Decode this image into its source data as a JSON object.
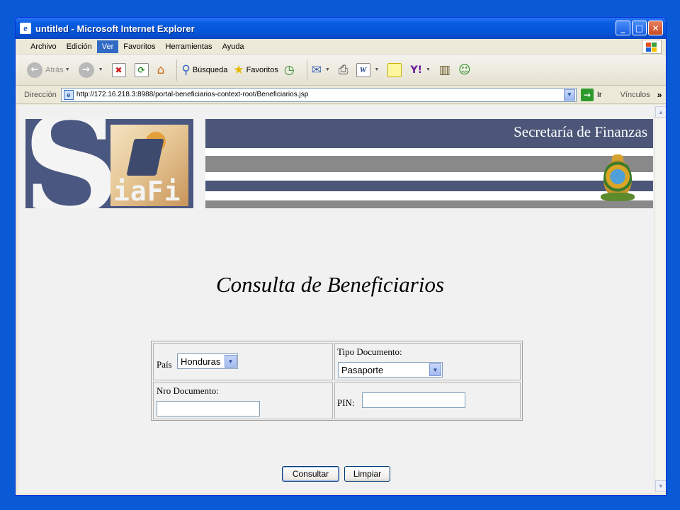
{
  "window": {
    "title": "untitled - Microsoft Internet Explorer"
  },
  "menu": {
    "items": [
      "Archivo",
      "Edición",
      "Ver",
      "Favoritos",
      "Herramientas",
      "Ayuda"
    ]
  },
  "toolbar": {
    "back_label": "Atrás",
    "search_label": "Búsqueda",
    "favorites_label": "Favoritos"
  },
  "address": {
    "label": "Dirección",
    "url": "http://172.16.218.3:8988/portal-beneficiarios-context-root/Beneficiarios.jsp",
    "go_label": "Ir",
    "links_label": "Vínculos"
  },
  "banner": {
    "title": "Secretaría de Finanzas",
    "logo_letter": "S",
    "logo_text": "iaFi"
  },
  "page": {
    "title": "Consulta de Beneficiarios"
  },
  "form": {
    "pais_label": "País",
    "pais_value": "Honduras",
    "tipo_label": "Tipo Documento:",
    "tipo_value": "Pasaporte",
    "nro_label": "Nro Documento:",
    "nro_value": "",
    "pin_label": "PIN:",
    "pin_value": ""
  },
  "buttons": {
    "consultar": "Consultar",
    "limpiar": "Limpiar"
  },
  "colors": {
    "xp_blue": "#0a5ad6",
    "banner_navy": "#4b5678",
    "banner_gray": "#898989"
  },
  "icons": [
    "ie-icon",
    "windows-logo-icon",
    "back-icon",
    "forward-icon",
    "stop-icon",
    "refresh-icon",
    "home-icon",
    "search-icon",
    "favorites-star-icon",
    "history-icon",
    "mail-icon",
    "print-icon",
    "edit-icon",
    "notes-icon",
    "yahoo-icon",
    "research-icon",
    "messenger-icon",
    "page-icon",
    "go-arrow-icon",
    "coat-of-arms-icon"
  ]
}
